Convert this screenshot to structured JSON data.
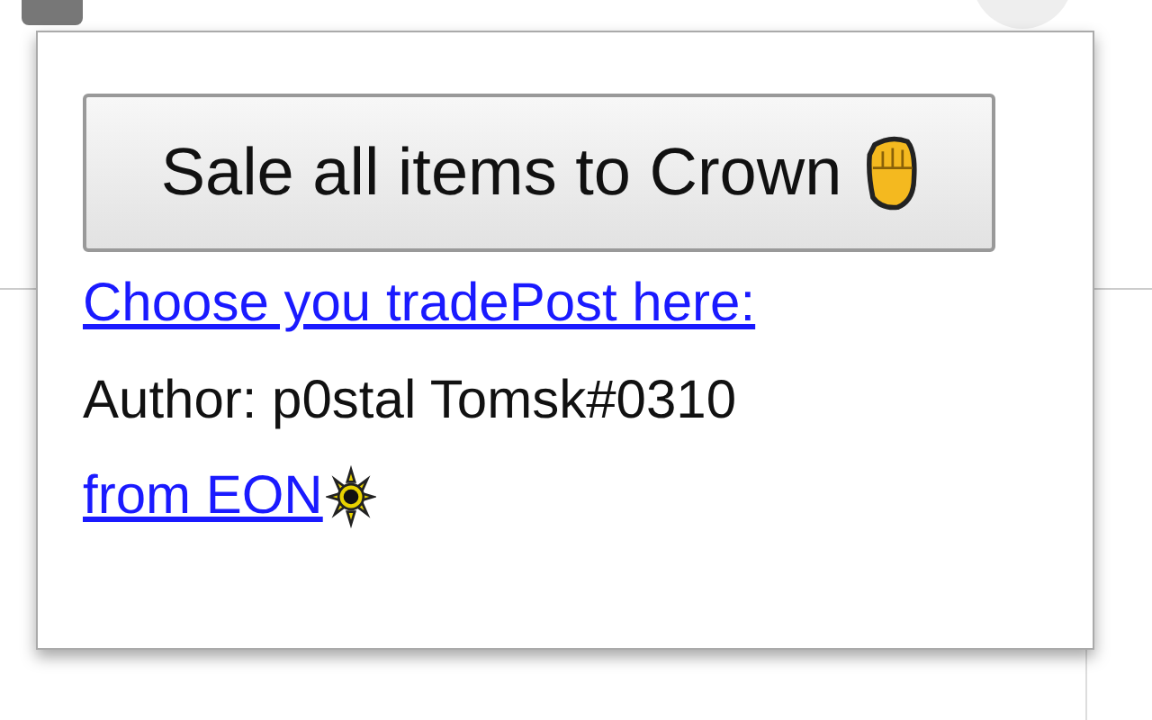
{
  "popup": {
    "button": {
      "label": "Sale all items to Crown"
    },
    "trade_post_link": "Choose you tradePost here:",
    "author": "Author: p0stal Tomsk#0310",
    "eon_link": "from EON "
  }
}
